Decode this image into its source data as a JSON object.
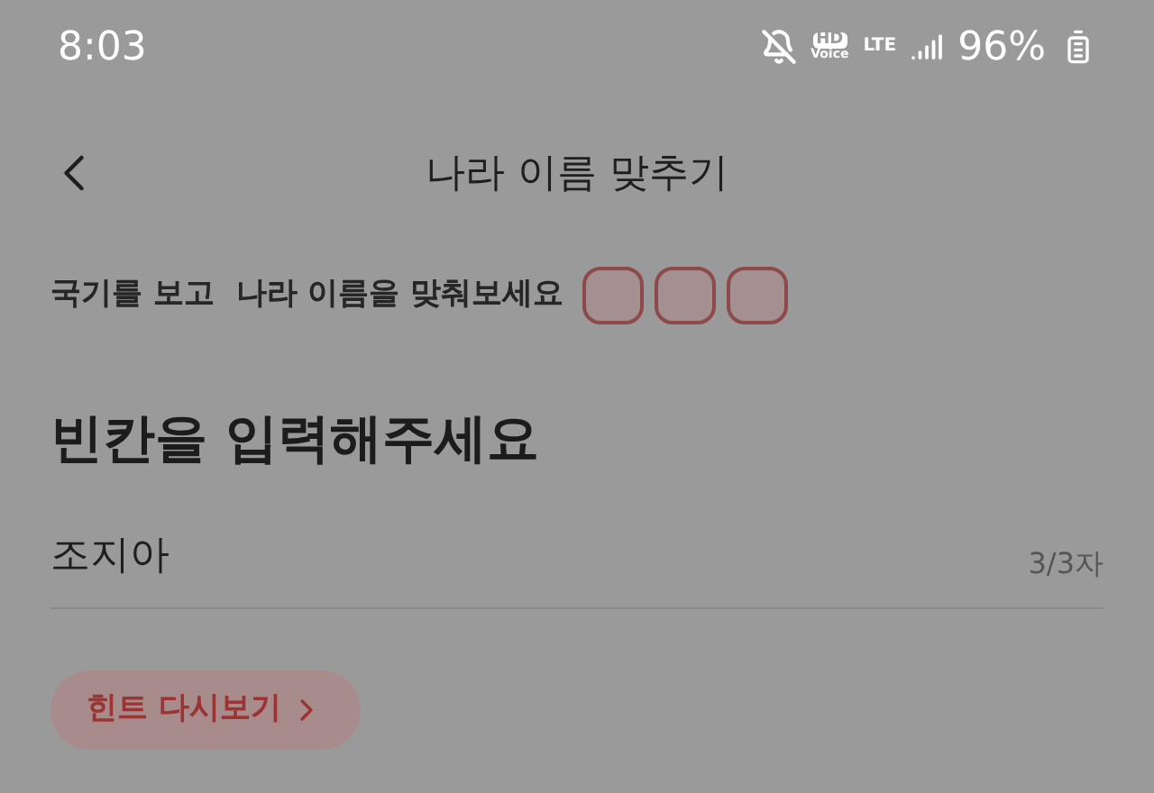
{
  "status_bar": {
    "time": "8:03",
    "hd": "HD",
    "voice": "Voice",
    "network": "LTE",
    "battery": "96%"
  },
  "header": {
    "title": "나라 이름 맞추기"
  },
  "instruction": {
    "text": "국기를 보고  나라 이름을 맞춰보세요",
    "slots": [
      {
        "kind": "empty"
      },
      {
        "kind": "empty"
      },
      {
        "kind": "empty"
      }
    ]
  },
  "heading": "빈칸을 입력해주세요",
  "answer": {
    "value": "조지아",
    "counter": "3/3자"
  },
  "hint_button": {
    "label": "힌트 다시보기"
  }
}
